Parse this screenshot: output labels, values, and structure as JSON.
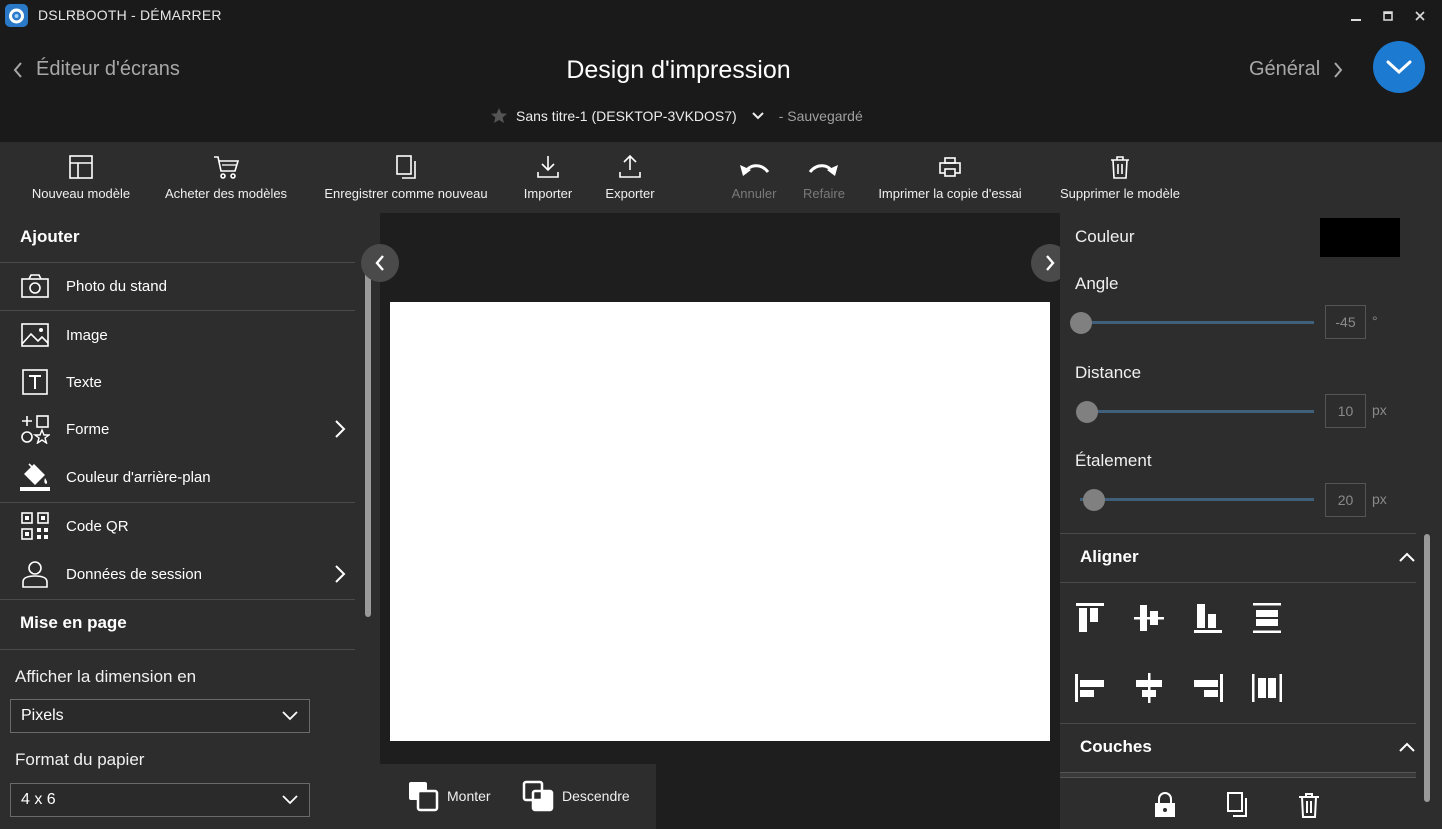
{
  "window": {
    "title": "DSLRBOOTH - DÉMARRER"
  },
  "header": {
    "back_label": "Éditeur d'écrans",
    "title": "Design d'impression",
    "forward_label": "Général",
    "document_name": "Sans titre-1 (DESKTOP-3VKDOS7)",
    "save_status": "- Sauvegardé"
  },
  "toolbar": {
    "new_template": "Nouveau modèle",
    "buy_templates": "Acheter des modèles",
    "save_as_new": "Enregistrer comme nouveau",
    "import": "Importer",
    "export": "Exporter",
    "undo": "Annuler",
    "redo": "Refaire",
    "print_test": "Imprimer la copie d'essai",
    "delete_template": "Supprimer le modèle"
  },
  "left": {
    "add_heading": "Ajouter",
    "items": [
      {
        "label": "Photo du stand",
        "icon": "camera-icon"
      },
      {
        "label": "Image",
        "icon": "image-icon"
      },
      {
        "label": "Texte",
        "icon": "text-icon"
      },
      {
        "label": "Forme",
        "icon": "shapes-icon"
      },
      {
        "label": "Couleur d'arrière-plan",
        "icon": "paint-bucket-icon"
      },
      {
        "label": "Code QR",
        "icon": "qr-code-icon"
      },
      {
        "label": "Données de session",
        "icon": "user-icon"
      }
    ],
    "layout_heading": "Mise en page",
    "dimension_label": "Afficher la dimension en",
    "dimension_value": "Pixels",
    "paper_label": "Format du papier",
    "paper_value": "4 x 6"
  },
  "canvas": {
    "background_color": "#ffffff"
  },
  "layer_actions": {
    "up": "Monter",
    "down": "Descendre"
  },
  "right": {
    "color_label": "Couleur",
    "color_value": "#000000",
    "angle_label": "Angle",
    "angle_value": "-45",
    "angle_unit": "°",
    "distance_label": "Distance",
    "distance_value": "10",
    "distance_unit": "px",
    "spread_label": "Étalement",
    "spread_value": "20",
    "spread_unit": "px",
    "align_heading": "Aligner",
    "layers_heading": "Couches"
  },
  "accent_color": "#1d7ad1"
}
